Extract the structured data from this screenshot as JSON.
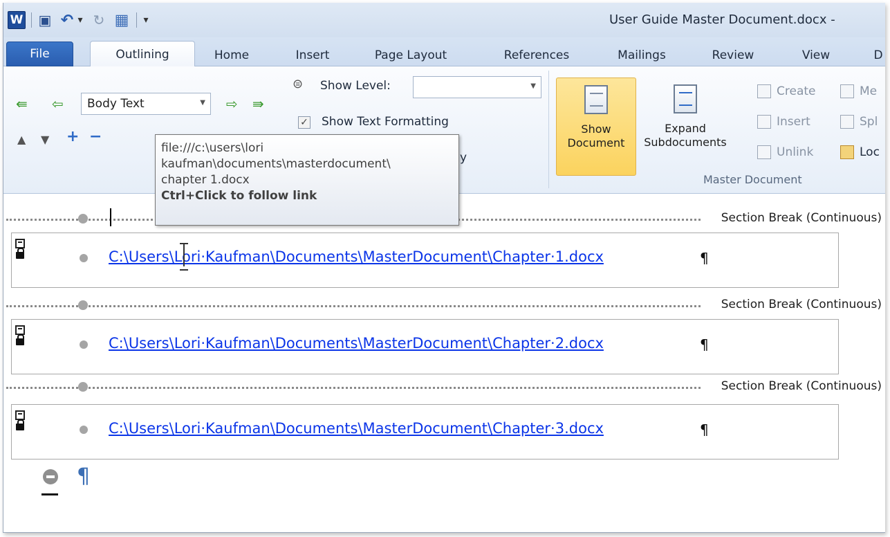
{
  "window": {
    "title": "User Guide Master Document.docx -",
    "app_icon_letter": "W"
  },
  "qat": {
    "items": [
      {
        "name": "save-icon",
        "glyph": "▣"
      },
      {
        "name": "undo-icon",
        "glyph": "↶"
      },
      {
        "name": "undo-dropdown-icon",
        "glyph": "▾"
      },
      {
        "name": "redo-icon",
        "glyph": "↻"
      },
      {
        "name": "print-preview-icon",
        "glyph": "▦"
      },
      {
        "name": "customize-qat-icon",
        "glyph": "▾"
      }
    ]
  },
  "tabs": [
    "File",
    "Outlining",
    "Home",
    "Insert",
    "Page Layout",
    "References",
    "Mailings",
    "Review",
    "View",
    "D"
  ],
  "ribbon": {
    "outline_tools": {
      "level_value": "Body Text",
      "show_level_label": "Show Level:",
      "show_text_formatting_label": "Show Text Formatting",
      "show_text_formatting_checked": true,
      "hidden_tail_text": "y"
    },
    "master_document": {
      "show_document_label_1": "Show",
      "show_document_label_2": "Document",
      "expand_label_1": "Expand",
      "expand_label_2": "Subdocuments",
      "create_label": "Create",
      "insert_label": "Insert",
      "unlink_label": "Unlink",
      "merge_label": "Me",
      "split_label": "Spl",
      "lock_label": "Loc",
      "group_label": "Master Document"
    }
  },
  "tooltip": {
    "line1": "file:///c:\\users\\lori",
    "line2": "kaufman\\documents\\masterdocument\\",
    "line3": "chapter 1.docx",
    "line4": "Ctrl+Click to follow link"
  },
  "document": {
    "section_break_text": "Section Break (Continuous)",
    "subdocuments": [
      {
        "link": "C:\\Users\\Lori·Kaufman\\Documents\\MasterDocument\\Chapter·1.docx",
        "pilcrow": "¶"
      },
      {
        "link": "C:\\Users\\Lori·Kaufman\\Documents\\MasterDocument\\Chapter·2.docx",
        "pilcrow": "¶"
      },
      {
        "link": "C:\\Users\\Lori·Kaufman\\Documents\\MasterDocument\\Chapter·3.docx",
        "pilcrow": "¶"
      }
    ],
    "end_pilcrow": "¶"
  }
}
